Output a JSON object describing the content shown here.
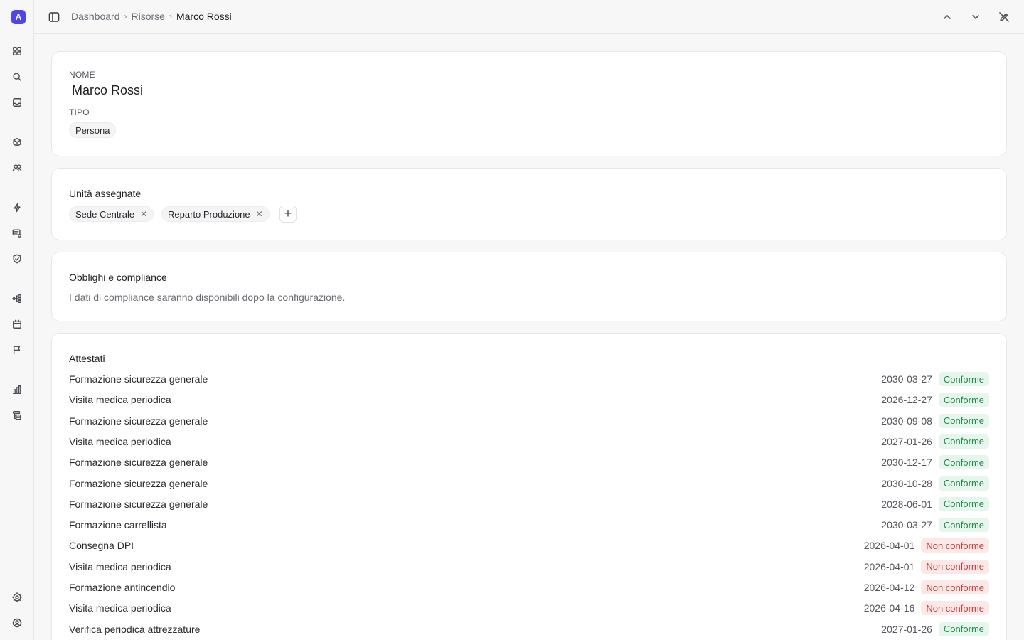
{
  "app": {
    "logo_letter": "A"
  },
  "sidebar": {
    "icons": [
      "grid-icon",
      "search-icon",
      "inbox-icon",
      "box-icon",
      "users-icon",
      "zap-icon",
      "chat-list-icon",
      "shield-check-icon",
      "workflow-icon",
      "calendar-icon",
      "flag-icon",
      "bar-chart-icon",
      "file-tree-icon",
      "settings-icon",
      "user-circle-icon"
    ]
  },
  "breadcrumb": {
    "items": [
      "Dashboard",
      "Risorse",
      "Marco Rossi"
    ]
  },
  "resource": {
    "name_label": "NOME",
    "name": "Marco Rossi",
    "type_label": "TIPO",
    "type": "Persona"
  },
  "units": {
    "title": "Unità assegnate",
    "items": [
      "Sede Centrale",
      "Reparto Produzione"
    ],
    "add_label": "+"
  },
  "compliance": {
    "title": "Obblighi e compliance",
    "message": "I dati di compliance saranno disponibili dopo la configurazione."
  },
  "attestati": {
    "title": "Attestati",
    "rows": [
      {
        "name": "Formazione sicurezza generale",
        "date": "2030-03-27",
        "status": "Conforme"
      },
      {
        "name": "Visita medica periodica",
        "date": "2026-12-27",
        "status": "Conforme"
      },
      {
        "name": "Formazione sicurezza generale",
        "date": "2030-09-08",
        "status": "Conforme"
      },
      {
        "name": "Visita medica periodica",
        "date": "2027-01-26",
        "status": "Conforme"
      },
      {
        "name": "Formazione sicurezza generale",
        "date": "2030-12-17",
        "status": "Conforme"
      },
      {
        "name": "Formazione sicurezza generale",
        "date": "2030-10-28",
        "status": "Conforme"
      },
      {
        "name": "Formazione sicurezza generale",
        "date": "2028-06-01",
        "status": "Conforme"
      },
      {
        "name": "Formazione carrellista",
        "date": "2030-03-27",
        "status": "Conforme"
      },
      {
        "name": "Consegna DPI",
        "date": "2026-04-01",
        "status": "Non conforme"
      },
      {
        "name": "Visita medica periodica",
        "date": "2026-04-01",
        "status": "Non conforme"
      },
      {
        "name": "Formazione antincendio",
        "date": "2026-04-12",
        "status": "Non conforme"
      },
      {
        "name": "Visita medica periodica",
        "date": "2026-04-16",
        "status": "Non conforme"
      },
      {
        "name": "Verifica periodica attrezzature",
        "date": "2027-01-26",
        "status": "Conforme"
      }
    ]
  },
  "colors": {
    "accent": "#4f46e5",
    "ok_bg": "#e6f6ec",
    "ok_fg": "#1f8a4a",
    "ko_bg": "#fde8e8",
    "ko_fg": "#c83a3a"
  }
}
